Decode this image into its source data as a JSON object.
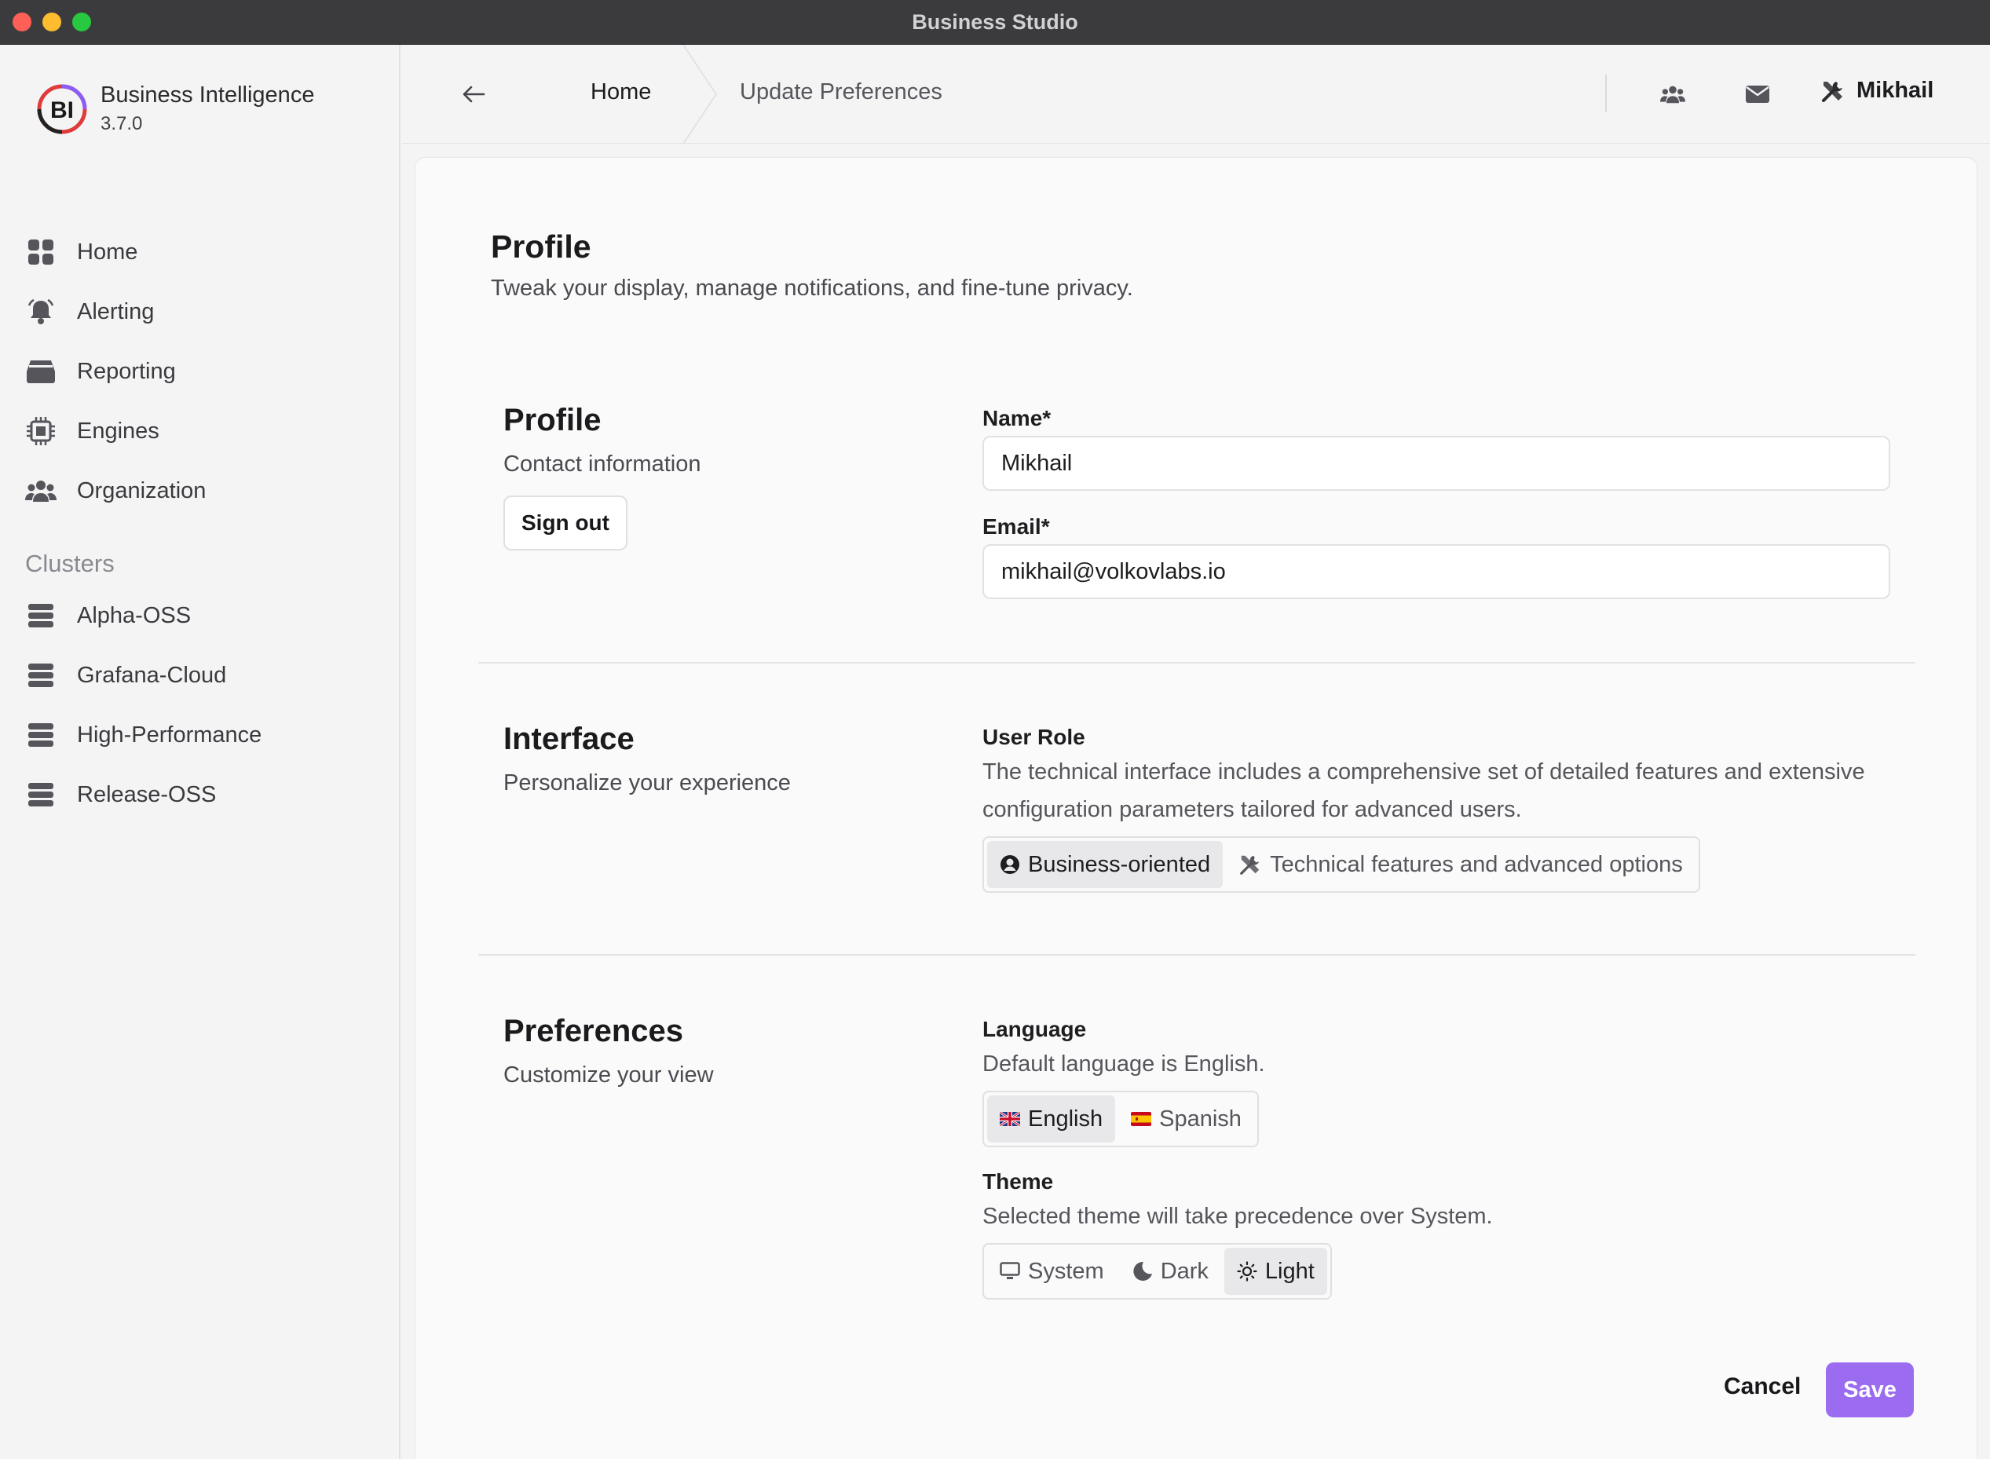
{
  "window": {
    "title": "Business Studio"
  },
  "brand": {
    "name": "Business Intelligence",
    "version": "3.7.0",
    "logo_text": "BI"
  },
  "nav": [
    {
      "label": "Home",
      "icon": "grid-icon"
    },
    {
      "label": "Alerting",
      "icon": "bell-icon"
    },
    {
      "label": "Reporting",
      "icon": "inbox-icon"
    },
    {
      "label": "Engines",
      "icon": "chip-icon"
    },
    {
      "label": "Organization",
      "icon": "users-icon"
    }
  ],
  "clusters": {
    "title": "Clusters",
    "items": [
      {
        "label": "Alpha-OSS",
        "icon": "server-icon"
      },
      {
        "label": "Grafana-Cloud",
        "icon": "server-icon"
      },
      {
        "label": "High-Performance",
        "icon": "server-icon"
      },
      {
        "label": "Release-OSS",
        "icon": "server-icon"
      }
    ]
  },
  "breadcrumb": {
    "home": "Home",
    "current": "Update Preferences"
  },
  "topbar": {
    "user_name": "Mikhail"
  },
  "page": {
    "title": "Profile",
    "subtitle": "Tweak your display, manage notifications, and fine-tune privacy."
  },
  "profile": {
    "title": "Profile",
    "subtitle": "Contact information",
    "sign_out": "Sign out",
    "name_label": "Name*",
    "name_value": "Mikhail",
    "email_label": "Email*",
    "email_value": "mikhail@volkovlabs.io"
  },
  "interface": {
    "title": "Interface",
    "subtitle": "Personalize your experience",
    "role_label": "User Role",
    "role_help": "The technical interface includes a comprehensive set of detailed features and extensive configuration parameters tailored for advanced users.",
    "options": [
      {
        "label": "Business-oriented",
        "icon": "user-circle-icon",
        "selected": true
      },
      {
        "label": "Technical features and advanced options",
        "icon": "tools-icon",
        "selected": false
      }
    ]
  },
  "preferences": {
    "title": "Preferences",
    "subtitle": "Customize your view",
    "language_label": "Language",
    "language_help": "Default language is English.",
    "languages": [
      {
        "label": "English",
        "icon": "uk-flag-icon",
        "selected": true
      },
      {
        "label": "Spanish",
        "icon": "spain-flag-icon",
        "selected": false
      }
    ],
    "theme_label": "Theme",
    "theme_help": "Selected theme will take precedence over System.",
    "themes": [
      {
        "label": "System",
        "icon": "monitor-icon",
        "selected": false
      },
      {
        "label": "Dark",
        "icon": "moon-icon",
        "selected": false
      },
      {
        "label": "Light",
        "icon": "sun-icon",
        "selected": true
      }
    ]
  },
  "actions": {
    "cancel": "Cancel",
    "save": "Save"
  },
  "colors": {
    "accent": "#9b6cf0",
    "sidebar_bg": "#f4f4f5",
    "titlebar_bg": "#3b3b3d"
  }
}
